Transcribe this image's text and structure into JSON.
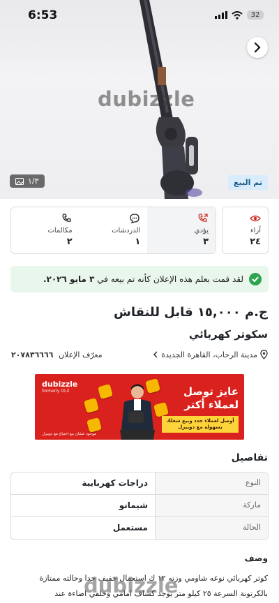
{
  "status_bar": {
    "time": "6:53",
    "battery": "32"
  },
  "hero": {
    "watermark": "dubizzle",
    "sold_badge": "تم البيع",
    "image_counter": "١/٣"
  },
  "stats": {
    "views": {
      "label": "آراء",
      "value": "٢٤"
    },
    "delivery": {
      "label": "يؤدي",
      "value": "٣"
    },
    "chats": {
      "label": "الدردشات",
      "value": "١"
    },
    "calls": {
      "label": "مكالمات",
      "value": "٢"
    }
  },
  "info_banner": {
    "text": "لقد قمت بعلم هذه الإعلان كأنه تم بيعه في",
    "date": "٣ مايو ٢٠٢٦."
  },
  "listing": {
    "price": "ج.م ١٥,٠٠٠ قابل للنقاش",
    "title": "سكوتر كهربائي",
    "location": "مدينة الرحاب، القاهرة الجديدة",
    "ad_id_label": "معرّف الإعلان",
    "ad_id": "٢٠٧٨٣٦٦٦٦"
  },
  "promo": {
    "logo": "dubizzle",
    "logo_sub": "formerly OLX",
    "headline_1": "عايز توصل",
    "headline_2": "لعملاء أكتر",
    "yellow_text": "أوصل لعملاء جدد وبيع شغلك بسهولة مع دوبيزل",
    "footer": "موجود عشان بيع احتياج مع دوبيزل"
  },
  "details": {
    "title": "تفاصيل",
    "rows": [
      {
        "key": "النوع",
        "value": "دراجات كهربايية"
      },
      {
        "key": "ماركة",
        "value": "شيمانو"
      },
      {
        "key": "الحالة",
        "value": "مستعمل"
      }
    ]
  },
  "description": {
    "title": "وصف",
    "line_1": "كوتر كهربائي نوعه شاومي وزنه ١٢ ك استعمال خفيف جدا وحالته ممتازة",
    "line_2": "بالكرتونة السرعة ٢٥ كيلو متر يوجد كشاف امامي وخلفي اضاءة عند",
    "watermark": "dubizzle"
  }
}
